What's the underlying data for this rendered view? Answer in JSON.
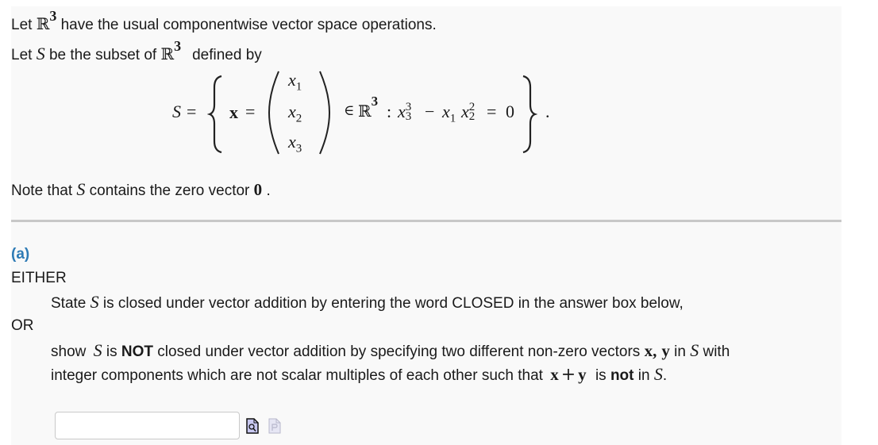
{
  "intro": {
    "line1_prefix": "Let ",
    "line1_space": "ℝ",
    "line1_exp": "3",
    "line1_suffix": " have the usual componentwise vector space operations.",
    "line2_prefix": "Let ",
    "line2_set": "S",
    "line2_mid": " be the subset of ",
    "line2_space": "ℝ",
    "line2_exp": "3",
    "line2_suffix": "defined by"
  },
  "formula": {
    "lhs": "S",
    "eq1": "=",
    "vec": "x",
    "eq2": "=",
    "components": [
      "x",
      "x",
      "x"
    ],
    "component_subs": [
      "1",
      "2",
      "3"
    ],
    "member": "∈",
    "space": "ℝ",
    "space_exp": "3",
    "colon": ":",
    "cond_var1": "x",
    "cond_var1_sub": "3",
    "cond_var1_sup": "3",
    "minus": "−",
    "cond_var2": "x",
    "cond_var2_sub": "1",
    "cond_var3": "x",
    "cond_var3_sub": "2",
    "cond_var3_sup": "2",
    "eq3": "=",
    "rhs": "0",
    "period": "."
  },
  "note": {
    "prefix": "Note that ",
    "set": "S",
    "mid": " contains the zero vector ",
    "zero": "0",
    "suffix": " ."
  },
  "part_a": {
    "label": "(a)",
    "either": "EITHER",
    "state_prefix": "State ",
    "state_set": "S",
    "state_suffix": " is closed under vector addition by entering the word CLOSED in the answer box below,",
    "or": "OR",
    "show_prefix": "show ",
    "show_set": "S",
    "show_is": " is ",
    "show_not": "NOT",
    "show_mid": " closed under vector addition by specifying  two different non-zero vectors ",
    "show_x": "x,",
    "show_y": "y",
    "show_in": " in ",
    "show_set2": "S",
    "show_with": " with",
    "line2_prefix": "integer components which are not scalar multiples of each other such that ",
    "line2_x": "x",
    "line2_plus": "+",
    "line2_y": "y",
    "line2_is": " is ",
    "line2_not": "not",
    "line2_in": " in ",
    "line2_set": "S",
    "line2_end": "."
  },
  "answer": {
    "value": "",
    "placeholder": ""
  },
  "icons": {
    "preview": "preview-icon",
    "palette": "palette-icon"
  },
  "colors": {
    "panel_bg": "#f9f9f9",
    "separator": "#c8c8c8",
    "part_label": "#2e7bb5",
    "preview_icon_fill": "#c8c8f0",
    "palette_icon_fill": "#e6e6f4"
  }
}
